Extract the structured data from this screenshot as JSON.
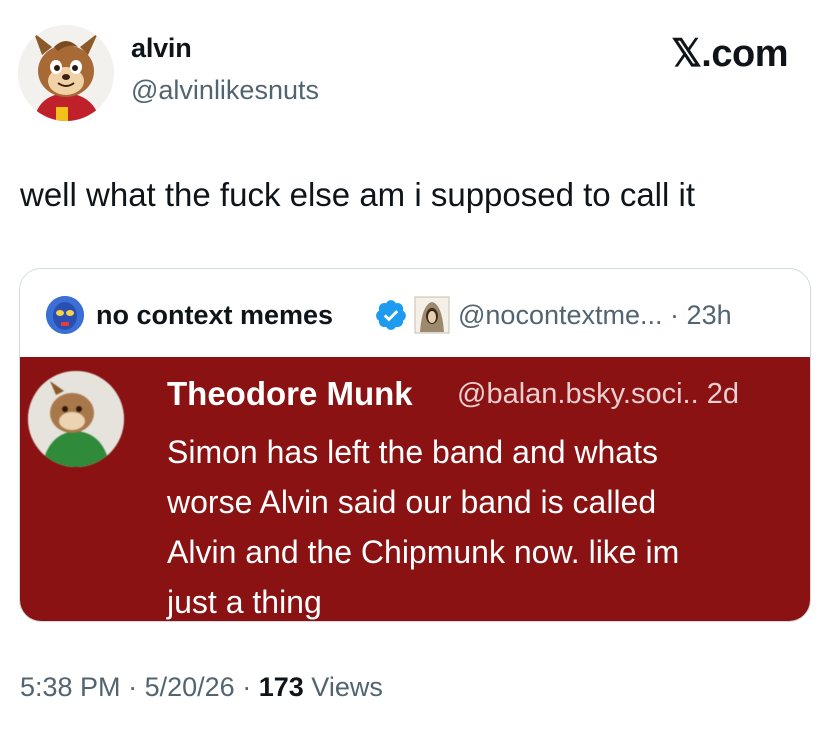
{
  "tweet": {
    "display_name": "alvin",
    "handle": "@alvinlikesnuts",
    "brand": "𝕏.com",
    "text": "well what the fuck else am i supposed to call it"
  },
  "quote": {
    "display_name": "no context memes",
    "handle": "@nocontextme...",
    "separator": "·",
    "time": "23h",
    "verified_icon": "verified-badge-icon",
    "media": {
      "author_name": "Theodore Munk",
      "author_handle": "@balan.bsky.soci..",
      "time": "2d",
      "lines": [
        "Simon has left the band and whats",
        "worse Alvin said our band is called",
        "Alvin and the Chipmunk now. like im",
        "just a thing"
      ],
      "background_color": "#8a1213"
    }
  },
  "meta": {
    "time": "5:38 PM",
    "sep1": "·",
    "date": "5/20/26",
    "sep2": "·",
    "views_count": "173",
    "views_label": "Views"
  },
  "colors": {
    "text_primary": "#0f1419",
    "text_secondary": "#536471",
    "verified": "#1d9bf0",
    "border": "#cfd9de"
  }
}
